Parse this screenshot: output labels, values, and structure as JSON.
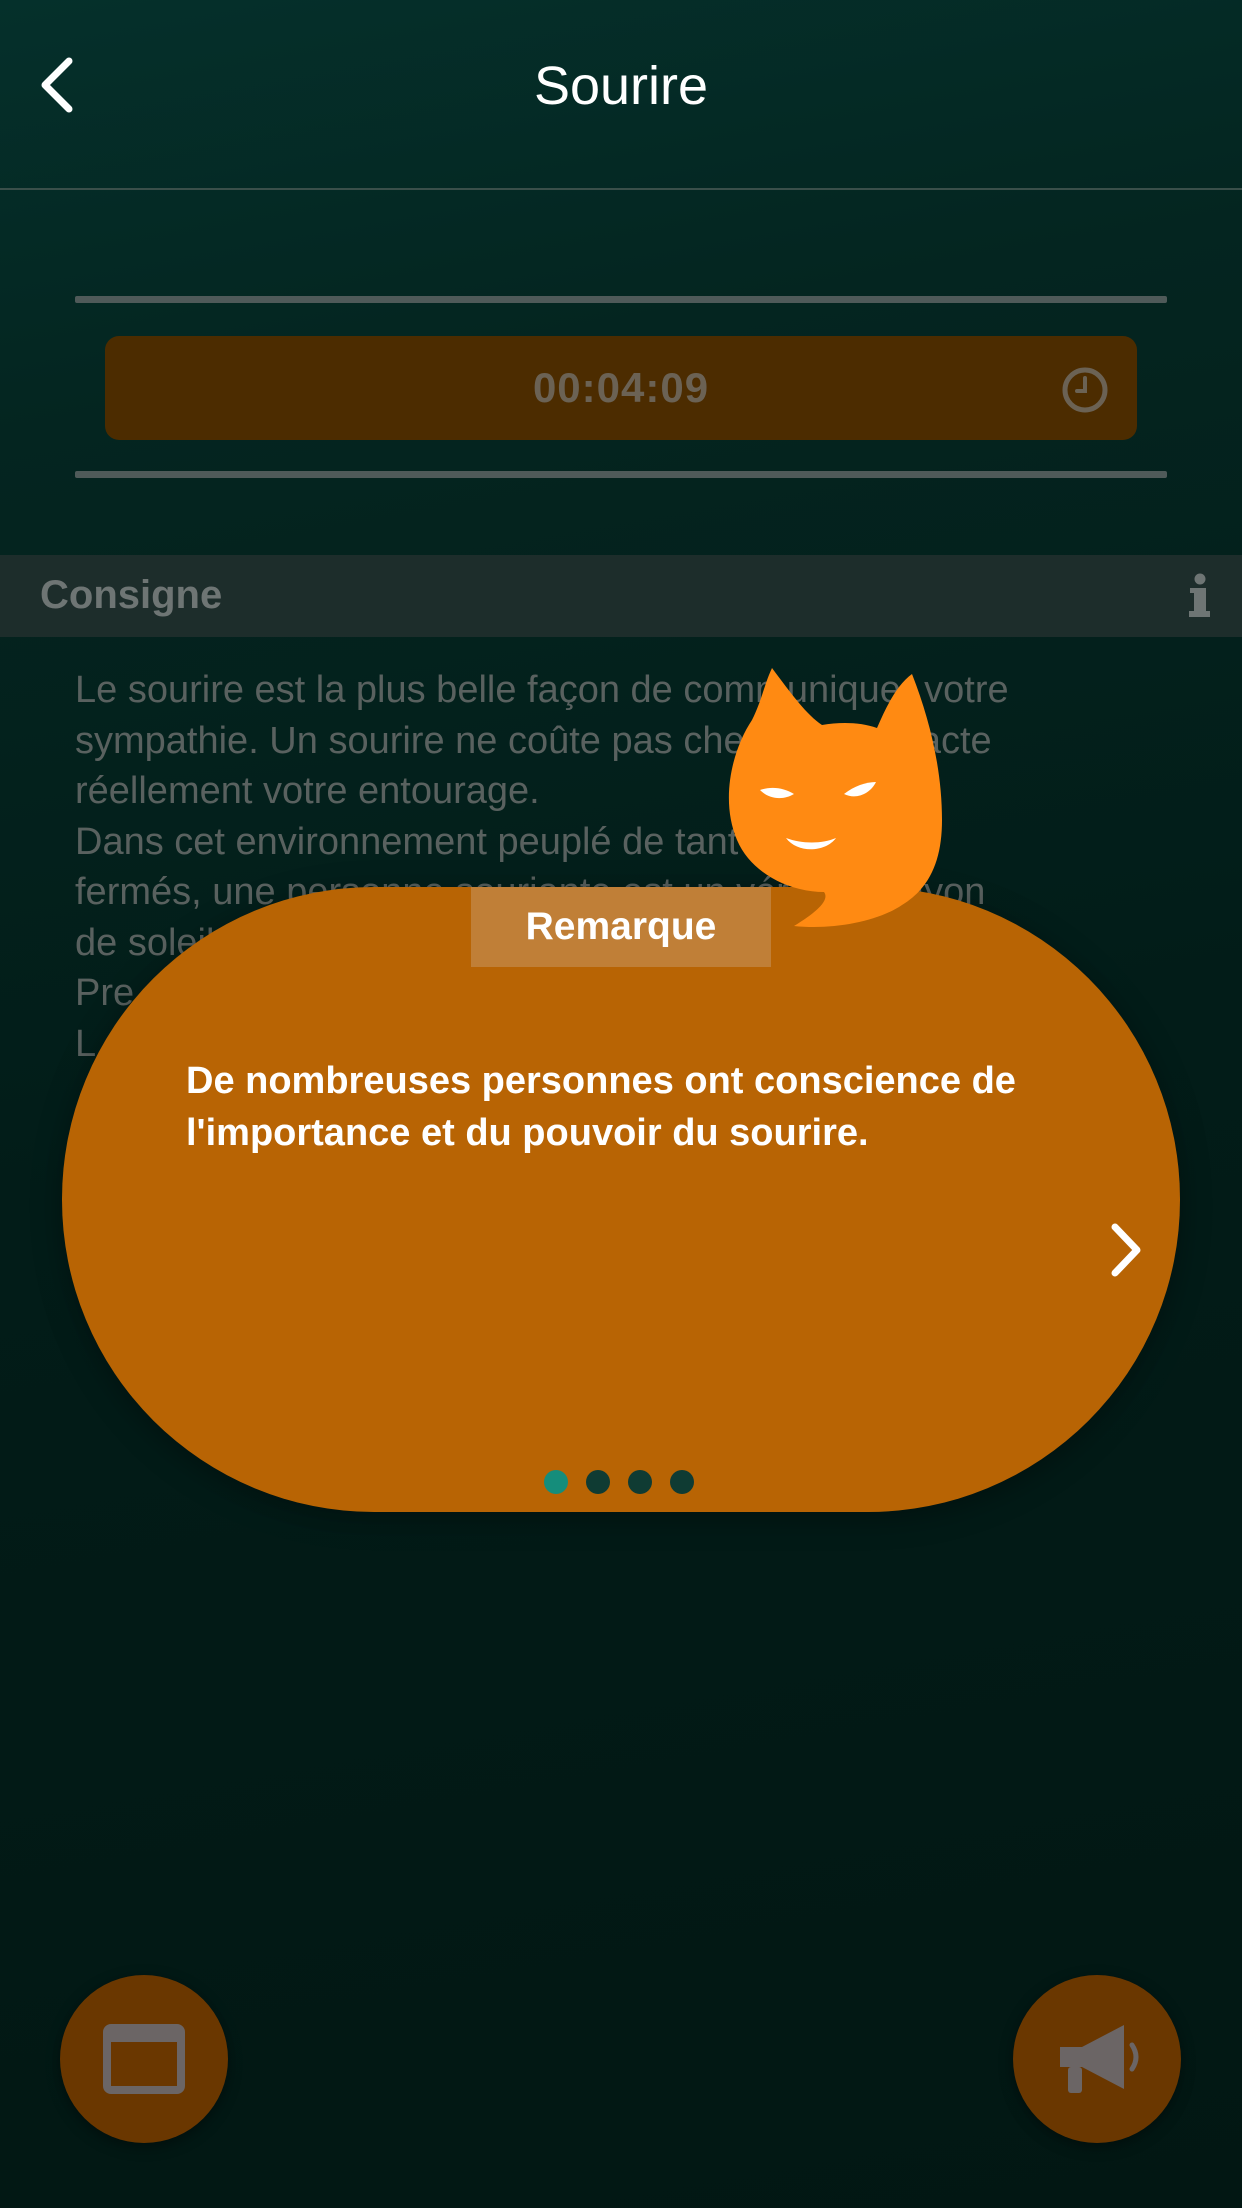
{
  "header": {
    "title": "Sourire",
    "back_icon": "chevron-left-icon"
  },
  "timer": {
    "value": "00:04:09",
    "icon": "clock-icon"
  },
  "instruction": {
    "section_title": "Consigne",
    "info_icon": "info-icon",
    "lines": [
      "Le sourire est la plus belle façon de communiquer votre",
      "sympathie. Un sourire ne coûte pas cher mais impacte",
      "réellement votre entourage.",
      "Dans cet environnement peuplé de tant de visages",
      "fermés, une personne souriante est un véritable rayon",
      "de soleil.",
      "Pre",
      "L"
    ]
  },
  "popup": {
    "tag": "Remarque",
    "message": "De nombreuses personnes ont conscience de l'importance et du pouvoir du sourire.",
    "next_icon": "chevron-right-icon",
    "page_count": 4,
    "current_page": 1,
    "mascot": "cat-mascot-icon"
  },
  "bottom_bar": {
    "left_button_icon": "window-icon",
    "right_button_icon": "megaphone-icon"
  },
  "colors": {
    "background": "#03231e",
    "accent_orange": "#b86404",
    "tag_orange": "#c07f37",
    "mascot_orange": "#ff8a12",
    "dot_active": "#158d7b",
    "dot_inactive": "#0f3b33",
    "fab_brown": "#6a3700"
  }
}
